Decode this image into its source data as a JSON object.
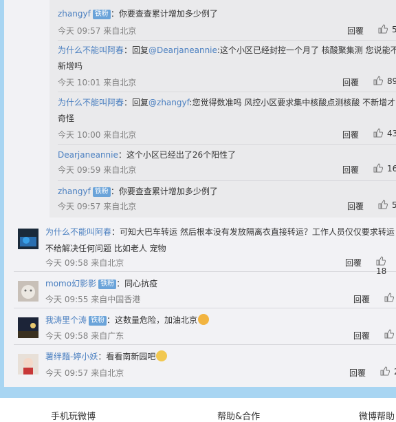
{
  "nested_replies": [
    {
      "user": "zhangyf",
      "badge": "铁粉",
      "text": "：你要查查累计增加多少例了",
      "meta": "今天 09:57 来自北京",
      "reply": "回覆",
      "likes": "5"
    },
    {
      "user": "为什么不能叫阿春",
      "badge": "",
      "text_before": "：回复",
      "mention": "@Dearjaneannie",
      "text_after": ":这个小区已经封控一个月了 核酸聚集测 您说能不新增吗",
      "meta": "今天 10:01 来自北京",
      "reply": "回覆",
      "likes": "89"
    },
    {
      "user": "为什么不能叫阿春",
      "badge": "",
      "text_before": "：回复",
      "mention": "@zhangyf",
      "text_after": ":您觉得数准吗 风控小区要求集中核酸点测核酸 不新增才奇怪",
      "meta": "今天 10:00 来自北京",
      "reply": "回覆",
      "likes": "43"
    },
    {
      "user": "Dearjaneannie",
      "badge": "",
      "text": "：这个小区已经出了26个阳性了",
      "meta": "今天 09:59 来自北京",
      "reply": "回覆",
      "likes": "16"
    },
    {
      "user": "zhangyf",
      "badge": "铁粉",
      "text": "：你要查查累计增加多少例了",
      "meta": "今天 09:57 来自北京",
      "reply": "回覆",
      "likes": "5"
    }
  ],
  "comments": [
    {
      "user": "为什么不能叫阿春",
      "badge": "",
      "text": "：可知大巴车转运 然后根本没有发放隔离衣直接转运？工作人员仅仅要求转运 不给解决任何问题 比如老人 宠物",
      "meta": "今天 09:58 来自北京",
      "reply": "回覆",
      "likes": "18"
    },
    {
      "user": "momo幻影影",
      "badge": "铁粉",
      "text": "：同心抗疫",
      "meta": "今天 09:55 来自中国香港",
      "reply": "回覆",
      "likes": ""
    },
    {
      "user": "我涛里个涛",
      "badge": "铁粉",
      "text": "：这数量危险，加油北京",
      "meta": "今天 09:58 来自广东",
      "reply": "回覆",
      "likes": ""
    },
    {
      "user": "薯绊麵-婷小妖",
      "badge": "",
      "text": "：看看南新园吧",
      "meta": "今天 09:57 来自北京",
      "reply": "回覆",
      "likes": "2"
    }
  ],
  "footer": {
    "left": "手机玩微博",
    "center": "帮助&合作",
    "right": "微博帮助"
  },
  "colors": {
    "link": "#4a7fc0",
    "badge": "#6aa3d9",
    "outer": "#a8d5f2",
    "panel": "#f2f2f5"
  }
}
